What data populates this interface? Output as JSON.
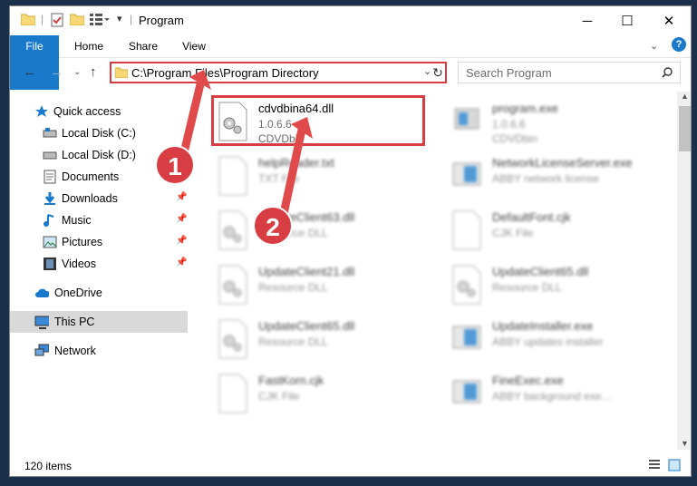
{
  "window": {
    "title": "Program"
  },
  "ribbon": {
    "tabs": [
      "File",
      "Home",
      "Share",
      "View"
    ]
  },
  "address": {
    "path": "C:\\Program Files\\Program Directory"
  },
  "search": {
    "placeholder": "Search Program"
  },
  "sidebar": {
    "items": [
      {
        "label": "Quick access",
        "icon": "star-icon"
      },
      {
        "label": "Local Disk (C:)",
        "icon": "drive-icon"
      },
      {
        "label": "Local Disk (D:)",
        "icon": "drive-icon"
      },
      {
        "label": "Documents",
        "icon": "documents-icon"
      },
      {
        "label": "Downloads",
        "icon": "download-icon"
      },
      {
        "label": "Music",
        "icon": "music-icon"
      },
      {
        "label": "Pictures",
        "icon": "pictures-icon"
      },
      {
        "label": "Videos",
        "icon": "videos-icon"
      },
      {
        "label": "OneDrive",
        "icon": "cloud-icon"
      },
      {
        "label": "This PC",
        "icon": "computer-icon"
      },
      {
        "label": "Network",
        "icon": "network-icon"
      }
    ]
  },
  "files": [
    {
      "name": "cdvdbina64.dll",
      "version": "1.0.6.6",
      "desc": "CDVDbin"
    },
    {
      "name": "program.exe",
      "version": "1.0.6.6",
      "desc": "CDVDbin"
    },
    {
      "name": "helpReader.txt",
      "version": "TXT File",
      "desc": ""
    },
    {
      "name": "NetworkLicenseServer.exe",
      "version": "ABBY network license",
      "desc": ""
    },
    {
      "name": "UpdateClient63.dll",
      "version": "Resource DLL",
      "desc": ""
    },
    {
      "name": "DefaultFont.cjk",
      "version": "CJK File",
      "desc": ""
    },
    {
      "name": "UpdateClient21.dll",
      "version": "Resource DLL",
      "desc": ""
    },
    {
      "name": "UpdateClient65.dll",
      "version": "Resource DLL",
      "desc": ""
    },
    {
      "name": "UpdateClient65.dll",
      "version": "Resource DLL",
      "desc": ""
    },
    {
      "name": "UpdateInstaller.exe",
      "version": "ABBY updates installer",
      "desc": ""
    },
    {
      "name": "FastKorn.cjk",
      "version": "CJK File",
      "desc": ""
    },
    {
      "name": "FineExec.exe",
      "version": "ABBY background exe...",
      "desc": ""
    }
  ],
  "status": {
    "count": "120 items"
  },
  "annotations": {
    "step1": "1",
    "step2": "2"
  },
  "colors": {
    "accent": "#1979ca",
    "highlight": "#d73d43"
  }
}
